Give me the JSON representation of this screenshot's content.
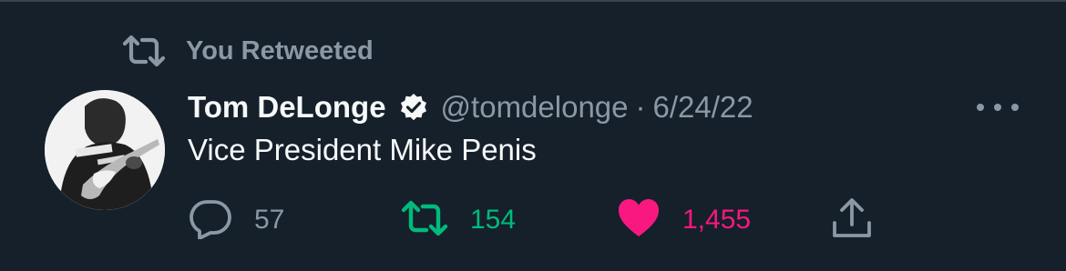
{
  "social_context": {
    "text": "You Retweeted",
    "icon": "retweet-icon"
  },
  "tweet": {
    "author": {
      "display_name": "Tom DeLonge",
      "handle": "@tomdelonge",
      "verified": true,
      "avatar": "avatar"
    },
    "separator": "·",
    "date": "6/24/22",
    "text": "Vice President Mike Penis",
    "actions": {
      "replies": "57",
      "retweets": "154",
      "likes": "1,455",
      "retweeted": true,
      "liked": true
    }
  },
  "colors": {
    "background": "#15202b",
    "text_primary": "#f7f9f9",
    "text_secondary": "#8b98a5",
    "retweet_green": "#00ba7c",
    "like_pink": "#f91880"
  }
}
